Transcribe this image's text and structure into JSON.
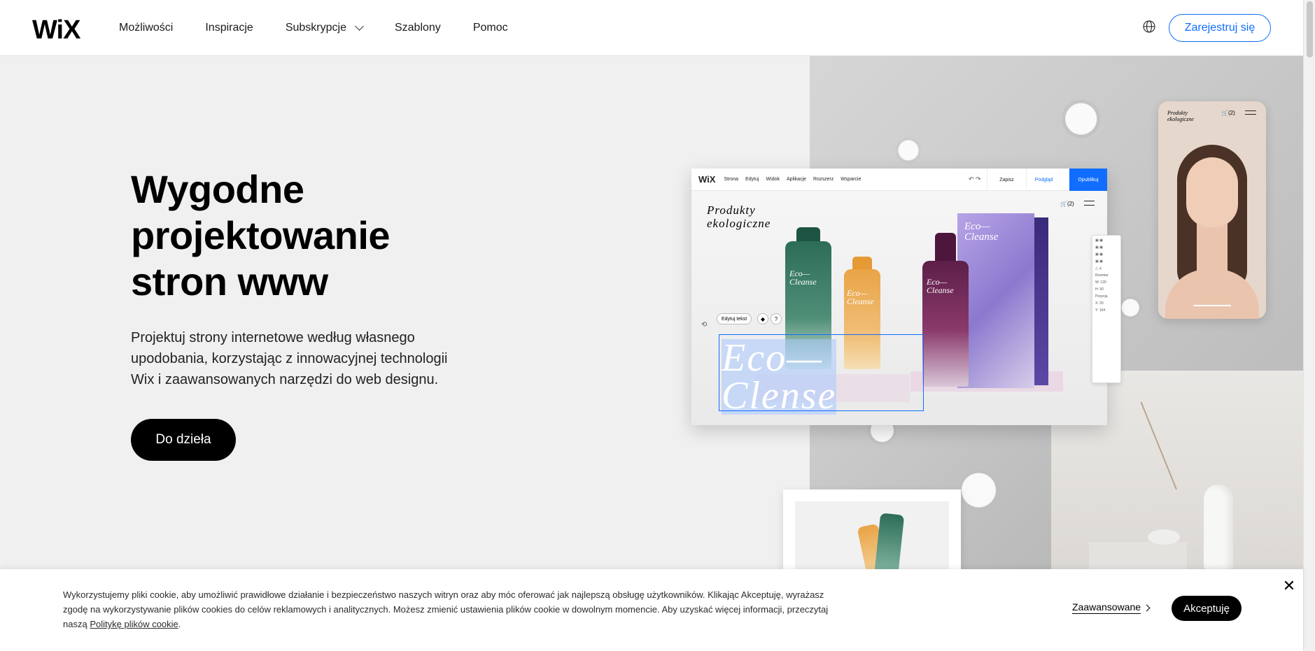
{
  "header": {
    "logo": "WiX",
    "nav": [
      {
        "label": "Możliwości"
      },
      {
        "label": "Inspiracje"
      },
      {
        "label": "Subskrypcje"
      },
      {
        "label": "Szablony"
      },
      {
        "label": "Pomoc"
      }
    ],
    "language_icon": "globe-icon",
    "signup_label": "Zarejestruj się"
  },
  "hero": {
    "title_line1": "Wygodne",
    "title_line2": "projektowanie",
    "title_line3": "stron www",
    "description": "Projektuj strony internetowe według własnego upodobania, korzystając z innowacyjnej technologii Wix i zaawansowanych narzędzi do web designu.",
    "cta_label": "Do dzieła"
  },
  "editor": {
    "logo": "WiX",
    "menu": [
      "Strona",
      "Edytuj",
      "Widok",
      "Aplikacje",
      "Rozszerz",
      "Wsparcie"
    ],
    "save": "Zapisz",
    "preview": "Podgląd",
    "publish": "Opublikuj",
    "brand_line1": "Produkty",
    "brand_line2": "ekologiczne",
    "cart": "(2)",
    "bottle_label_1": "Eco—",
    "bottle_label_2": "Cleanse",
    "edit_text_chip": "Edytuj tekst",
    "selected_text_line1": "Eco—",
    "selected_text_line2": "Clense",
    "panel": {
      "size_label": "Rozmiar",
      "w_label": "W:",
      "w_value": "120",
      "h_label": "H:",
      "h_value": "50",
      "position_label": "Pozycja",
      "x_label": "X:",
      "x_value": "20",
      "y_label": "Y:",
      "y_value": "164"
    }
  },
  "phone": {
    "brand_line1": "Produkty",
    "brand_line2": "ekologiczne",
    "cart": "(2)"
  },
  "cookie": {
    "text_main": "Wykorzystujemy pliki cookie, aby umożliwić prawidłowe działanie i bezpieczeństwo naszych witryn oraz aby móc oferować jak najlepszą obsługę użytkowników. Klikając Akceptuję, wyrażasz zgodę na wykorzystywanie plików cookies do celów reklamowych i analitycznych. Możesz zmienić ustawienia plików cookie w dowolnym momencie. Aby uzyskać więcej informacji, przeczytaj naszą",
    "policy_link": "Politykę plików cookie",
    "text_end": ".",
    "advanced_label": "Zaawansowane",
    "accept_label": "Akceptuję",
    "close_icon": "close-icon"
  }
}
